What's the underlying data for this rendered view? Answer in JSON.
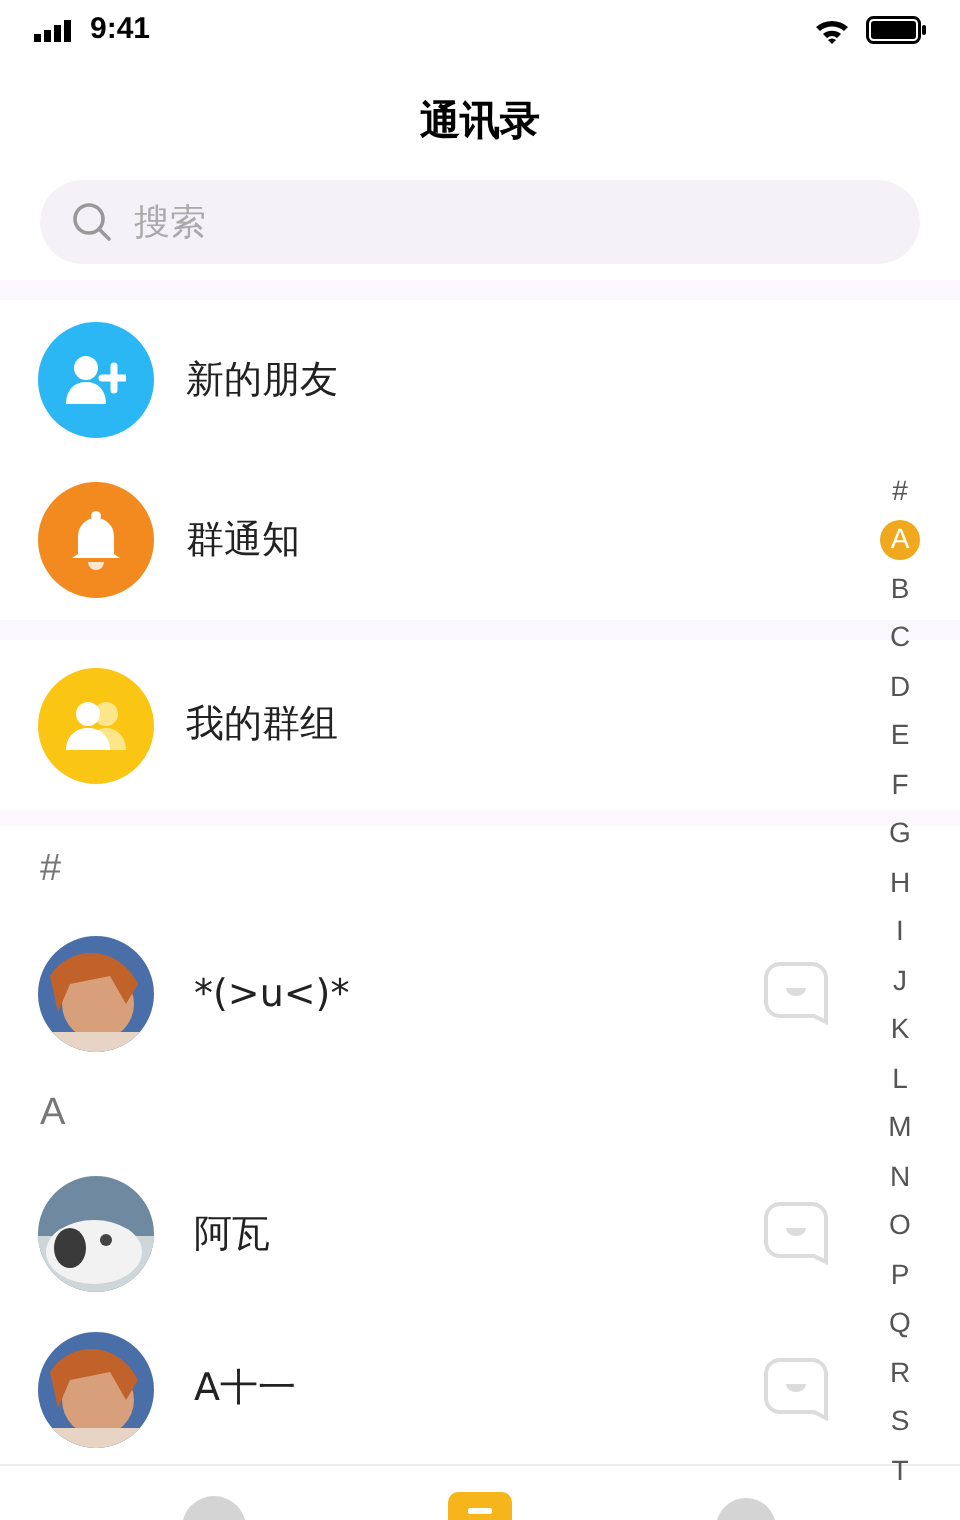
{
  "status_bar": {
    "time": "9:41"
  },
  "title": "通讯录",
  "search": {
    "placeholder": "搜索"
  },
  "shortcuts": [
    {
      "kind": "new_friend",
      "label": "新的朋友",
      "color": "#2bb7f3"
    },
    {
      "kind": "group_notice",
      "label": "群通知",
      "color": "#f38a1f"
    },
    {
      "kind": "my_groups",
      "label": "我的群组",
      "color": "#fbc513"
    }
  ],
  "sections": [
    {
      "header": "#",
      "contacts": [
        {
          "name": "*(>u<)*"
        }
      ]
    },
    {
      "header": "A",
      "contacts": [
        {
          "name": "阿瓦"
        },
        {
          "name": "A十一"
        }
      ]
    }
  ],
  "index": [
    {
      "letter": "#",
      "selected": false
    },
    {
      "letter": "A",
      "selected": true
    },
    {
      "letter": "B",
      "selected": false
    },
    {
      "letter": "C",
      "selected": false
    },
    {
      "letter": "D",
      "selected": false
    },
    {
      "letter": "E",
      "selected": false
    },
    {
      "letter": "F",
      "selected": false
    },
    {
      "letter": "G",
      "selected": false
    },
    {
      "letter": "H",
      "selected": false
    },
    {
      "letter": "I",
      "selected": false
    },
    {
      "letter": "J",
      "selected": false
    },
    {
      "letter": "K",
      "selected": false
    },
    {
      "letter": "L",
      "selected": false
    },
    {
      "letter": "M",
      "selected": false
    },
    {
      "letter": "N",
      "selected": false
    },
    {
      "letter": "O",
      "selected": false
    },
    {
      "letter": "P",
      "selected": false
    },
    {
      "letter": "Q",
      "selected": false
    },
    {
      "letter": "R",
      "selected": false
    },
    {
      "letter": "S",
      "selected": false
    },
    {
      "letter": "T",
      "selected": false
    }
  ],
  "tab_bar": [
    {
      "kind": "chat",
      "selected": false
    },
    {
      "kind": "contacts",
      "selected": true
    },
    {
      "kind": "me",
      "selected": false
    }
  ]
}
